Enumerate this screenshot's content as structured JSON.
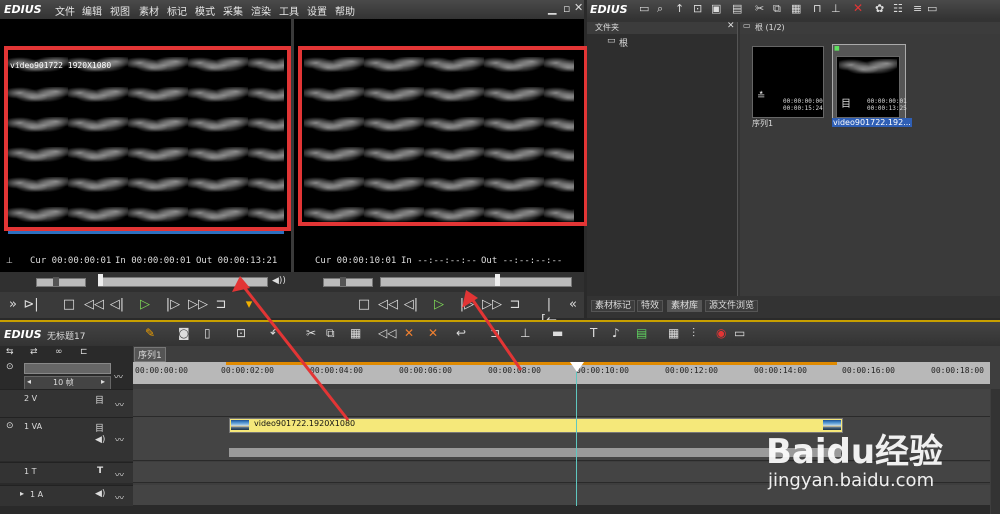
{
  "app": {
    "name": "EDIUS"
  },
  "menu": [
    "文件",
    "编辑",
    "视图",
    "素材",
    "标记",
    "模式",
    "采集",
    "渲染",
    "工具",
    "设置",
    "帮助"
  ],
  "player": {
    "overlay_label": "video901722 1920X1080",
    "cur": "Cur 00:00:00:01",
    "in": "In 00:00:00:01",
    "out": "Out 00:00:13:21"
  },
  "recorder": {
    "cur": "Cur 00:00:10:01",
    "in": "In --:--:--:--",
    "out": "Out --:--:--:--"
  },
  "bin": {
    "brand": "EDIUS",
    "folder_header": "文件夹",
    "root_folder": "根",
    "path_label": "根 (1/2)",
    "items": [
      {
        "name": "序列1",
        "tc1": "00:00:00:00",
        "tc2": "00:00:15:24"
      },
      {
        "name": "video901722.192...",
        "tc1": "00:00:00:01",
        "tc2": "00:00:13:25"
      }
    ],
    "tabs": [
      "素材标记",
      "特效",
      "素材库",
      "源文件浏览"
    ]
  },
  "timeline": {
    "brand": "EDIUS",
    "project_name": "无标题17",
    "sequence_tab": "序列1",
    "zoom": "10 帧",
    "ruler": [
      "00:00:00:00",
      "00:00:02:00",
      "00:00:04:00",
      "00:00:06:00",
      "00:00:08:00",
      "00:00:10:00",
      "00:00:12:00",
      "00:00:14:00",
      "00:00:16:00",
      "00:00:18:00"
    ],
    "tracks": [
      "2 V",
      "1 VA",
      "1 T",
      "1 A"
    ],
    "clip_name": "video901722.1920X1080"
  },
  "watermark": {
    "logo": "Baidu经验",
    "url": "jingyan.baidu.com"
  },
  "colors": {
    "accent_red": "#e23535",
    "clip_yellow": "#f5e87a",
    "playhead": "#5fc7c0"
  }
}
